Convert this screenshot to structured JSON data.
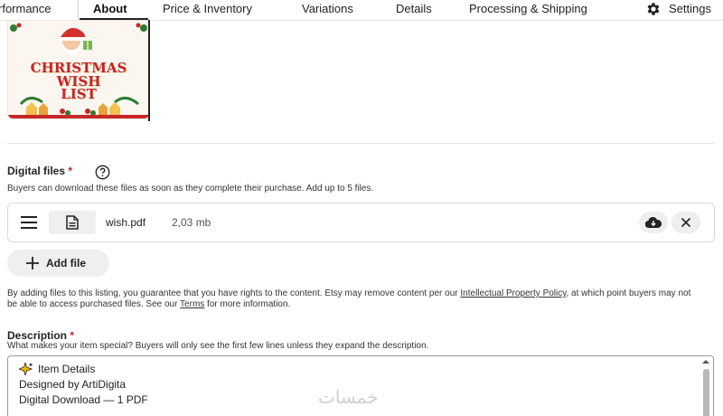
{
  "tabs": [
    {
      "label": "rformance"
    },
    {
      "label": "About"
    },
    {
      "label": "Price & Inventory"
    },
    {
      "label": "Variations"
    },
    {
      "label": "Details"
    },
    {
      "label": "Processing & Shipping"
    },
    {
      "label": "Settings"
    }
  ],
  "active_tab": "About",
  "thumbnail": {
    "line1": "CHRISTMAS",
    "line2": "WISH",
    "line3": "LIST"
  },
  "digital_files": {
    "label": "Digital files",
    "required_marker": "*",
    "help_text": "Buyers can download these files as soon as they complete their purchase. Add up to 5 files.",
    "files": [
      {
        "name": "wish.pdf",
        "size": "2,03 mb"
      }
    ],
    "add_file_label": "Add file",
    "terms_text_1": "By adding files to this listing, you guarantee that you have rights to the content. Etsy may remove content per our ",
    "terms_link_1": "Intellectual Property Policy",
    "terms_text_2": ", at which point buyers may not be able to access purchased files. See our ",
    "terms_link_2": "Terms",
    "terms_text_3": " for more information."
  },
  "description": {
    "label": "Description",
    "required_marker": "*",
    "help_text": "What makes your item special? Buyers will only see the first few lines unless they expand the description.",
    "lines": [
      "Item Details",
      "Designed by ArtiDigita",
      "Digital Download — 1 PDF"
    ]
  },
  "watermark": "خمسات",
  "colors": {
    "required": "#c0272d",
    "active_tab_underline": "#222222"
  }
}
